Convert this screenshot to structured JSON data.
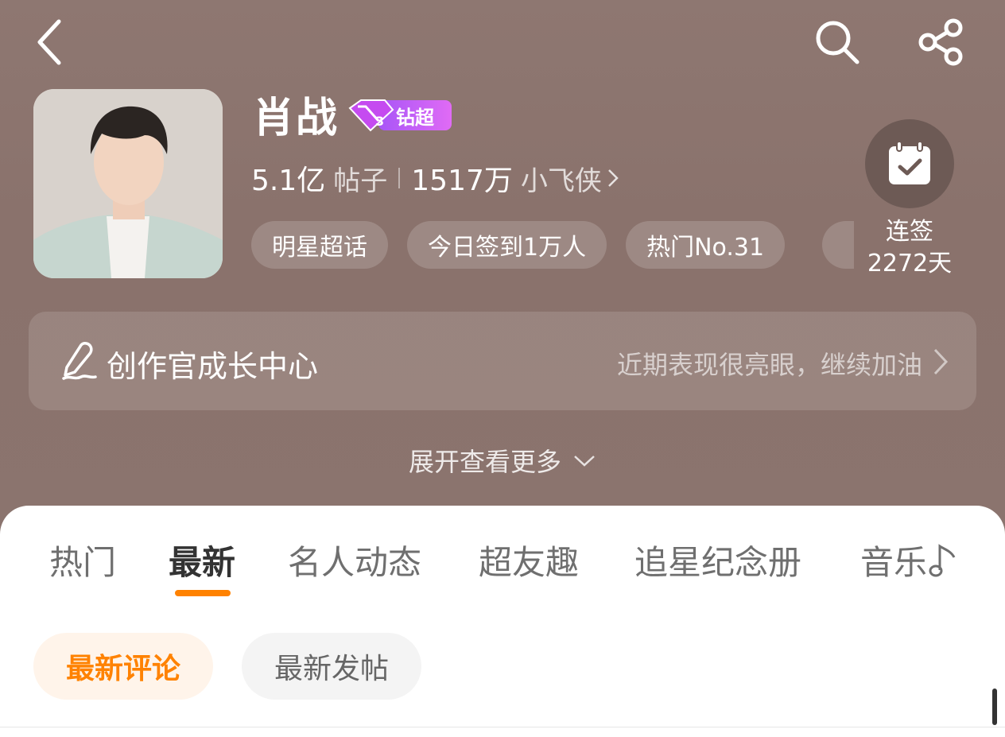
{
  "header": {
    "back_icon": "chevron-left-icon",
    "search_icon": "search-icon",
    "share_icon": "share-icon"
  },
  "profile": {
    "name": "肖战",
    "badge": {
      "level": "3",
      "label": "钻超",
      "color": "#c94dff"
    },
    "posts_count": "5.1亿",
    "posts_unit": "帖子",
    "followers_count": "1517万",
    "followers_unit": "小飞侠",
    "tags": [
      "明星超话",
      "今日签到1万人",
      "热门No.31"
    ]
  },
  "checkin": {
    "icon": "calendar-check-icon",
    "label": "连签",
    "days": "2272天"
  },
  "growth_center": {
    "icon": "pen-signature-icon",
    "title": "创作官成长中心",
    "subtitle": "近期表现很亮眼，继续加油"
  },
  "expand": {
    "label": "展开查看更多"
  },
  "tabs": [
    {
      "label": "热门",
      "active": false
    },
    {
      "label": "最新",
      "active": true
    },
    {
      "label": "名人动态",
      "active": false
    },
    {
      "label": "超友趣",
      "active": false
    },
    {
      "label": "追星纪念册",
      "active": false
    },
    {
      "label": "音乐",
      "active": false
    }
  ],
  "sort_chips": [
    {
      "label": "最新评论",
      "active": true
    },
    {
      "label": "最新发帖",
      "active": false
    }
  ],
  "colors": {
    "accent": "#ff8200",
    "hero_bg": "#8b746e"
  }
}
